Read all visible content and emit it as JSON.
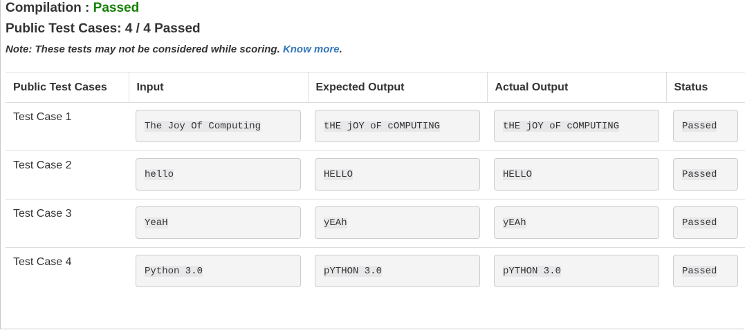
{
  "compilation": {
    "label": "Compilation : ",
    "status": "Passed",
    "status_color": "#138000"
  },
  "public_summary": "Public Test Cases: 4 / 4 Passed",
  "note": {
    "text": "Note: These tests may not be considered while scoring. ",
    "link_text": "Know more",
    "trailing": ".",
    "link_color": "#3377bb"
  },
  "table": {
    "headers": [
      "Public Test Cases",
      "Input",
      "Expected Output",
      "Actual Output",
      "Status"
    ],
    "rows": [
      {
        "name": "Test Case 1",
        "input": "The Joy Of Computing",
        "expected": "tHE jOY oF cOMPUTING",
        "actual": "tHE jOY oF cOMPUTING",
        "status": "Passed"
      },
      {
        "name": "Test Case 2",
        "input": "hello",
        "expected": "HELLO",
        "actual": "HELLO",
        "status": "Passed"
      },
      {
        "name": "Test Case 3",
        "input": "YeaH",
        "expected": "yEAh",
        "actual": "yEAh",
        "status": "Passed"
      },
      {
        "name": "Test Case 4",
        "input": "Python 3.0",
        "expected": "pYTHON 3.0",
        "actual": "pYTHON 3.0",
        "status": "Passed"
      }
    ]
  }
}
